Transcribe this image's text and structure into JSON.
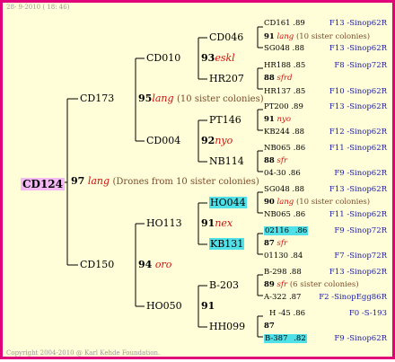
{
  "header": {
    "date": "28- 9-2010 ( 18: 46)"
  },
  "footer": {
    "copyright": "Copyright 2004-2010 @ Karl Kehde Foundation."
  },
  "root": {
    "id": "CD124",
    "score": "97",
    "name": "lang",
    "note": "(Drones from 10 sister colonies)"
  },
  "gen1": [
    {
      "id": "CD173",
      "score": "95",
      "name": "lang",
      "note": "(10 sister colonies)"
    },
    {
      "id": "CD150",
      "score": "94",
      "name": "oro",
      "note": ""
    }
  ],
  "gen2": [
    {
      "id": "CD010",
      "score": "93",
      "name": "eskl",
      "note": ""
    },
    {
      "id": "CD004",
      "score": "92",
      "name": "nyo",
      "note": ""
    },
    {
      "id": "HO113",
      "score": "91",
      "name": "nex",
      "note": ""
    },
    {
      "id": "HO050",
      "score": "91",
      "name": "",
      "note": ""
    }
  ],
  "gen3": [
    {
      "id": "CD046",
      "score": "91",
      "name": "lang",
      "note": "(10 sister colonies)"
    },
    {
      "id": "HR207",
      "score": "88",
      "name": "sfrd",
      "note": ""
    },
    {
      "id": "PT146",
      "score": "91",
      "name": "nyo",
      "note": ""
    },
    {
      "id": "NB114",
      "score": "88",
      "name": "sfr",
      "note": ""
    },
    {
      "id": "HO044",
      "score": "90",
      "name": "lang",
      "note": "(10 sister colonies)"
    },
    {
      "id": "KB131",
      "score": "87",
      "name": "sfr",
      "note": ""
    },
    {
      "id": "B-203",
      "score": "89",
      "name": "sfr",
      "note": "(6 sister colonies)"
    },
    {
      "id": "HH099",
      "score": "87",
      "name": "",
      "note": ""
    }
  ],
  "gen4": [
    {
      "id": "CD161",
      "score": ".89",
      "source": "F13 -Sinop62R"
    },
    {
      "id": "SG048",
      "score": ".88",
      "source": "F13 -Sinop62R"
    },
    {
      "id": "HR188",
      "score": ".85",
      "source": "F8 -Sinop72R"
    },
    {
      "id": "HR137",
      "score": ".85",
      "source": "F10 -Sinop62R"
    },
    {
      "id": "PT200",
      "score": ".89",
      "source": "F13 -Sinop62R"
    },
    {
      "id": "KB244",
      "score": ".88",
      "source": "F12 -Sinop62R"
    },
    {
      "id": "NB065",
      "score": ".86",
      "source": "F11 -Sinop62R"
    },
    {
      "id": "04-30",
      "score": ".86",
      "source": "F9 -Sinop62R"
    },
    {
      "id": "SG048",
      "score": ".88",
      "source": "F13 -Sinop62R"
    },
    {
      "id": "NB065",
      "score": ".86",
      "source": "F11 -Sinop62R"
    },
    {
      "id": "02116",
      "score": ".86",
      "source": "F9 -Sinop72R"
    },
    {
      "id": "01130",
      "score": ".84",
      "source": "F7 -Sinop72R"
    },
    {
      "id": "B-298",
      "score": ".88",
      "source": "F13 -Sinop62R"
    },
    {
      "id": "A-322",
      "score": ".87",
      "source": "F2 -SinopEgg86R"
    },
    {
      "id": "H -45",
      "score": ".86",
      "source": "F0 -S-193"
    },
    {
      "id": "B-387",
      "score": ".82",
      "source": "F9 -Sinop62R"
    }
  ]
}
